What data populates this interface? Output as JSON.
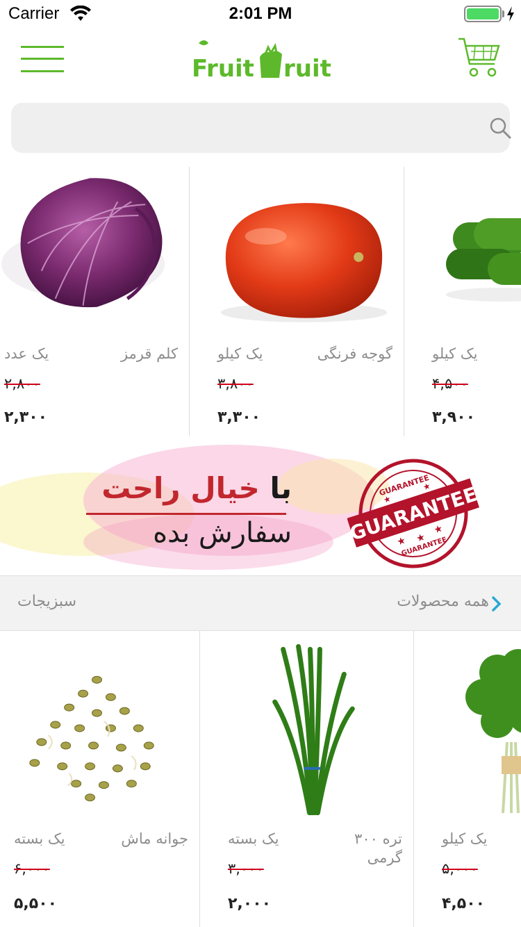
{
  "status_bar": {
    "carrier": "Carrier",
    "time": "2:01 PM"
  },
  "nav": {
    "logo_text": "Fruit Hruit",
    "menu_icon": "hamburger-icon",
    "cart_icon": "cart-icon",
    "brand_color": "#5db92b"
  },
  "search": {
    "placeholder": "",
    "value": "",
    "icon": "search-icon"
  },
  "top_products": [
    {
      "name": "کلم قرمز",
      "unit": "یک عدد",
      "old_price": "۲,۸۰۰",
      "price": "۲,۳۰۰"
    },
    {
      "name": "گوجه فرنگی",
      "unit": "یک کیلو",
      "old_price": "۳,۸۰۰",
      "price": "۳,۳۰۰"
    },
    {
      "name": "",
      "unit": "یک کیلو",
      "old_price": "۴,۵۰۰",
      "price": "۳,۹۰۰"
    }
  ],
  "banner": {
    "line1_prefix": "با",
    "line1_highlight": "خیال راحت",
    "line2": "سفارش بده",
    "stamp_text": "GUARANTEE",
    "stamp_small": "GUARANTEE",
    "stamp_bottom": "GUARANTEE"
  },
  "section": {
    "title": "سبزیجات",
    "see_all": "همه محصولات"
  },
  "vegetables": [
    {
      "name": "جوانه ماش",
      "unit": "یک بسته",
      "old_price": "۶,۰۰۰",
      "price": "۵,۵۰۰"
    },
    {
      "name": "تره ۳۰۰ گرمی",
      "unit": "یک بسته",
      "old_price": "۳,۰۰۰",
      "price": "۲,۰۰۰"
    },
    {
      "name": "",
      "unit": "یک کیلو",
      "old_price": "۵,۰۰۰",
      "price": "۴,۵۰۰"
    }
  ],
  "colors": {
    "accent_green": "#5db92b",
    "strike_red": "#d0021b",
    "chevron_blue": "#2aa7d6",
    "stamp_red": "#b3132b"
  }
}
